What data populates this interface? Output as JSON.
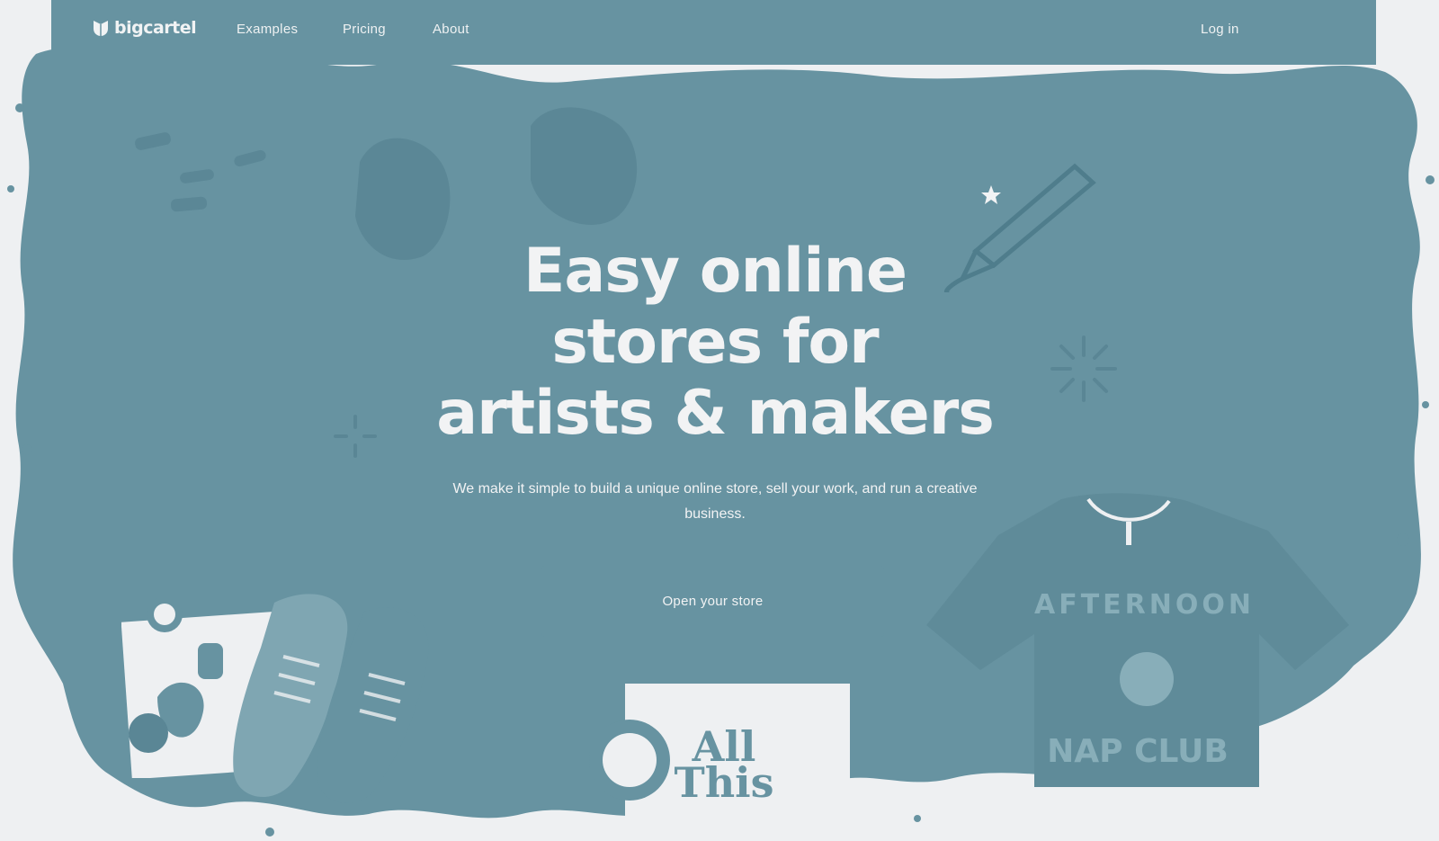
{
  "brand": {
    "name": "bigcartel",
    "colors": {
      "primary": "#6793a1",
      "light": "#eef0f2",
      "text_on_primary": "#f2f3f4"
    }
  },
  "nav": {
    "links": [
      {
        "label": "Examples"
      },
      {
        "label": "Pricing"
      },
      {
        "label": "About"
      }
    ],
    "login_label": "Log in"
  },
  "hero": {
    "title_lines": [
      "Easy online",
      "stores for",
      "artists & makers"
    ],
    "subtitle": "We make it simple to build a unique online store, sell your work, and run a creative business.",
    "cta_label": "Open your store"
  },
  "products": {
    "shirt_text_top": "AFTERNOON",
    "shirt_text_bottom": "NAP CLUB",
    "print_text": "All This"
  },
  "icons": [
    "bigcartel-logo-icon",
    "pencil-icon",
    "sparkle-icon",
    "star-icon"
  ]
}
